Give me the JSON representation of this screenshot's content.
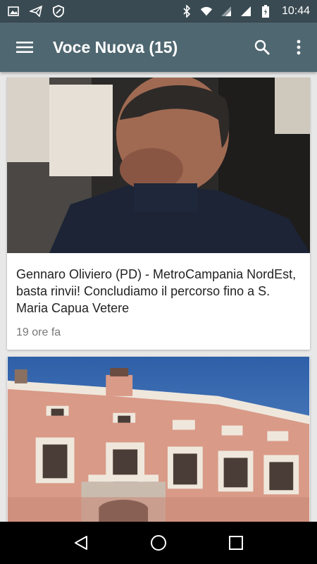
{
  "status_bar": {
    "time": "10:44",
    "left_icons": [
      "image-icon",
      "send-icon",
      "data-saver-icon"
    ],
    "right_icons": [
      "bluetooth-icon",
      "wifi-icon",
      "signal-icon",
      "signal-icon",
      "battery-icon"
    ]
  },
  "app_bar": {
    "title": "Voce Nuova (15)",
    "background": "#4f6770"
  },
  "feed": {
    "articles": [
      {
        "title": "Gennaro Oliviero (PD) - MetroCampania NordEst, basta rinvii! Concludiamo il percorso fino a S. Maria Capua Vetere",
        "time": "19 ore fa"
      },
      {
        "title": "",
        "time": ""
      }
    ]
  },
  "nav_bar": {
    "buttons": [
      "back-icon",
      "home-icon",
      "recents-icon"
    ]
  }
}
